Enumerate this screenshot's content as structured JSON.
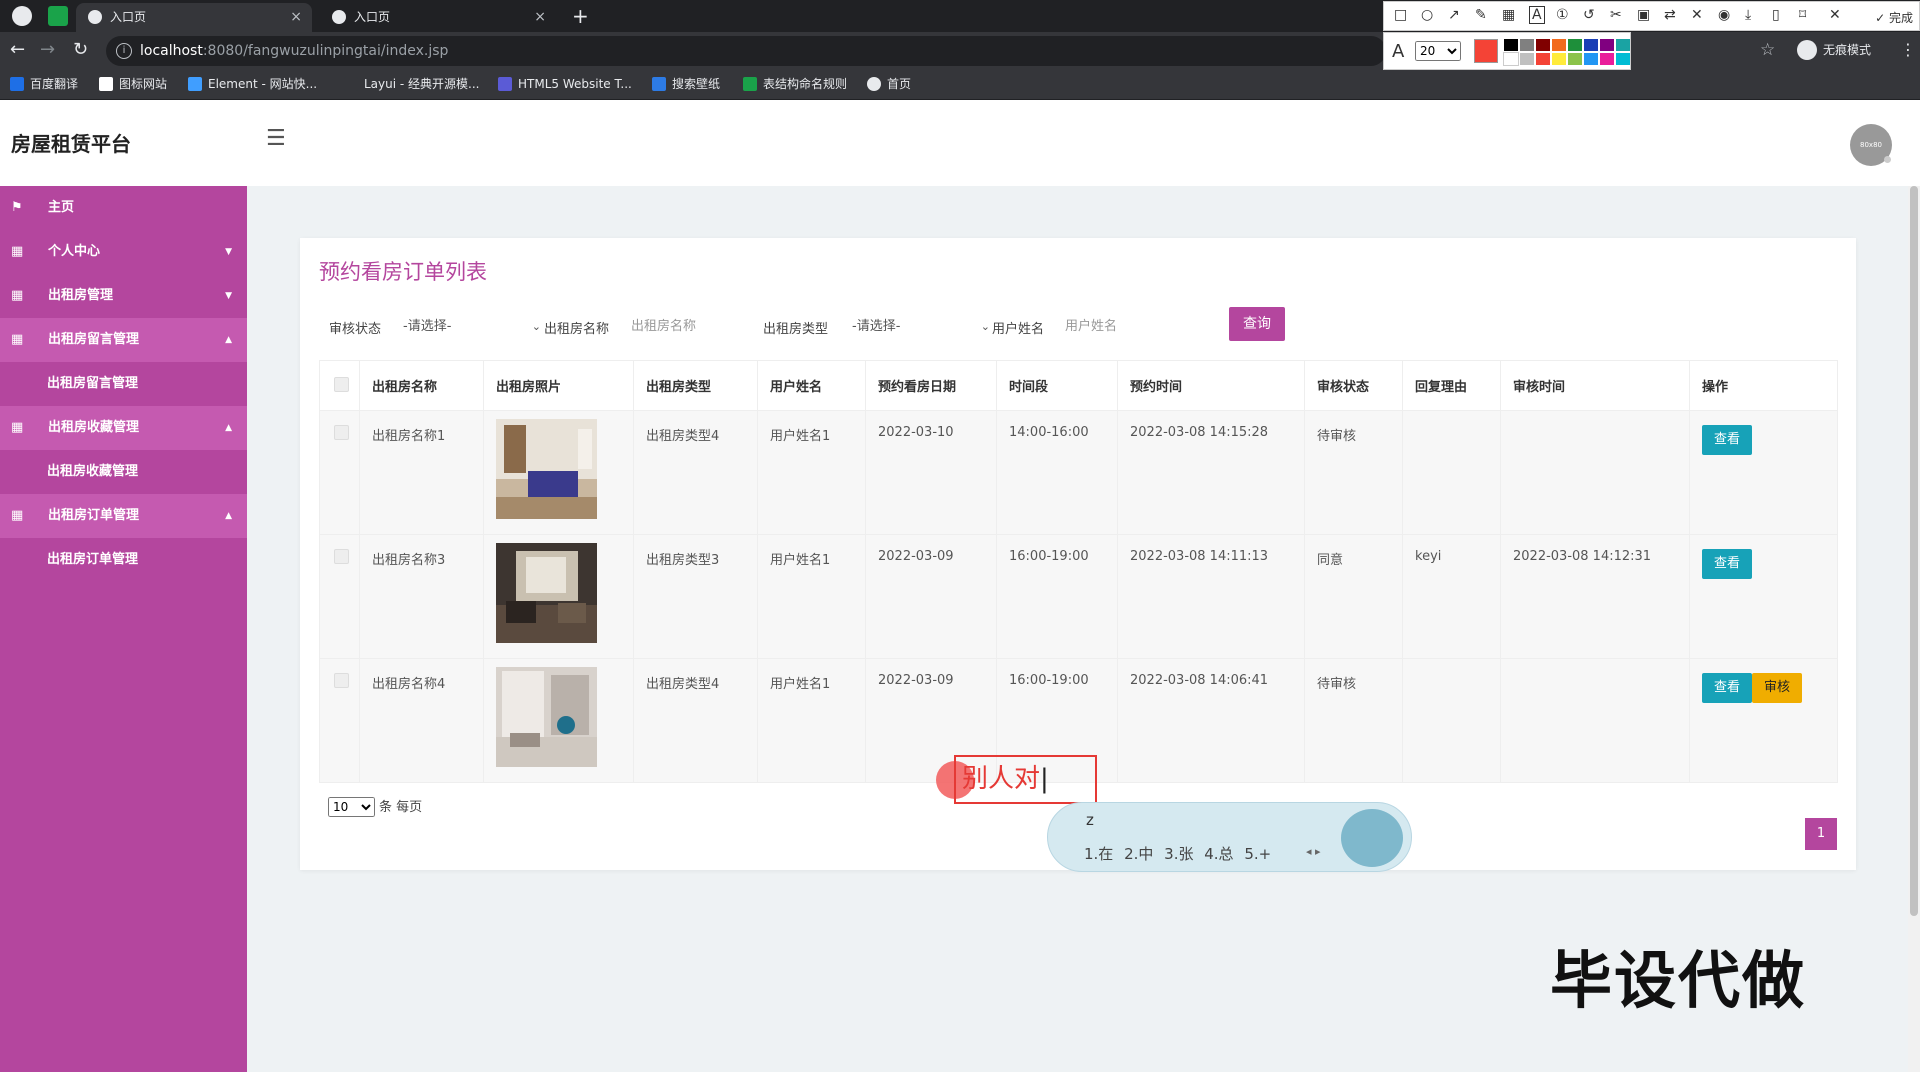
{
  "browser": {
    "tabs": [
      {
        "title": "入口页",
        "close": "×"
      },
      {
        "title": "入口页",
        "close": "×"
      }
    ],
    "new_tab": "+",
    "url_host": "localhost",
    "url_path": ":8080/fangwuzulinpingtai/index.jsp",
    "incognito_label": "无痕模式",
    "bookmarks": [
      {
        "label": "百度翻译",
        "color": "#1e6fe6"
      },
      {
        "label": "图标网站",
        "color": "#ffffff"
      },
      {
        "label": "Element - 网站快...",
        "color": "#409eff"
      },
      {
        "label": "Layui - 经典开源模...",
        "color": "#35363a"
      },
      {
        "label": "HTML5 Website T...",
        "color": "#5b5bd6"
      },
      {
        "label": "搜索壁纸",
        "color": "#2d7be5"
      },
      {
        "label": "表结构命名规则",
        "color": "#1aa34a"
      },
      {
        "label": "首页",
        "color": "#e8eaed"
      }
    ]
  },
  "snip_tool": {
    "done_label": "✓ 完成",
    "font_size_value": "20",
    "current_color": "#f44336",
    "swatches": [
      "#000000",
      "#808080",
      "#800000",
      "#f26b1d",
      "#1e8f3a",
      "#1a3fb5",
      "#800080",
      "#1aa3a3",
      "#ffffff",
      "#c0c0c0",
      "#f44336",
      "#ffeb3b",
      "#8bc34a",
      "#2196f3",
      "#e91e9b",
      "#00bcd4"
    ]
  },
  "app": {
    "brand": "房屋租赁平台",
    "avatar_text": "80x80",
    "accent": "#b4469e"
  },
  "sidebar": {
    "items": [
      {
        "label": "主页",
        "icon": "flag-icon",
        "glyph": "⚑",
        "caret": ""
      },
      {
        "label": "个人中心",
        "icon": "grid-icon",
        "glyph": "▦",
        "caret": "▼"
      },
      {
        "label": "出租房管理",
        "icon": "grid-icon",
        "glyph": "▦",
        "caret": "▼"
      },
      {
        "label": "出租房留言管理",
        "icon": "grid-icon",
        "glyph": "▦",
        "caret": "▲",
        "sub": "出租房留言管理"
      },
      {
        "label": "出租房收藏管理",
        "icon": "grid-icon",
        "glyph": "▦",
        "caret": "▲",
        "sub": "出租房收藏管理"
      },
      {
        "label": "出租房订单管理",
        "icon": "grid-icon",
        "glyph": "▦",
        "caret": "▲",
        "sub": "出租房订单管理"
      }
    ]
  },
  "main": {
    "title": "预约看房订单列表",
    "filters": {
      "status_label": "审核状态",
      "status_value": "-请选择-",
      "name_label": "出租房名称",
      "name_placeholder": "出租房名称",
      "type_label": "出租房类型",
      "type_value": "-请选择-",
      "user_label": "用户姓名",
      "user_placeholder": "用户姓名",
      "query_button": "查询"
    },
    "columns": [
      "出租房名称",
      "出租房照片",
      "出租房类型",
      "用户姓名",
      "预约看房日期",
      "时间段",
      "预约时间",
      "审核状态",
      "回复理由",
      "审核时间",
      "操作"
    ],
    "rows": [
      {
        "name": "出租房名称1",
        "type": "出租房类型4",
        "user": "用户姓名1",
        "date": "2022-03-10",
        "slot": "14:00-16:00",
        "booked": "2022-03-08 14:15:28",
        "status": "待审核",
        "reply": "",
        "audit_time": "",
        "view": "查看",
        "audit": ""
      },
      {
        "name": "出租房名称3",
        "type": "出租房类型3",
        "user": "用户姓名1",
        "date": "2022-03-09",
        "slot": "16:00-19:00",
        "booked": "2022-03-08 14:11:13",
        "status": "同意",
        "reply": "keyi",
        "audit_time": "2022-03-08 14:12:31",
        "view": "查看",
        "audit": ""
      },
      {
        "name": "出租房名称4",
        "type": "出租房类型4",
        "user": "用户姓名1",
        "date": "2022-03-09",
        "slot": "16:00-19:00",
        "booked": "2022-03-08 14:06:41",
        "status": "待审核",
        "reply": "",
        "audit_time": "",
        "view": "查看",
        "audit": "审核"
      }
    ],
    "pager": {
      "page_size": "10",
      "per_page_label": "条 每页",
      "current_page": "1"
    }
  },
  "overlays": {
    "annotation_text": "别人对",
    "ime_composition": "z",
    "ime_candidates": "1.在 2.中 3.张 4.总 5.+",
    "watermark": "毕设代做"
  }
}
